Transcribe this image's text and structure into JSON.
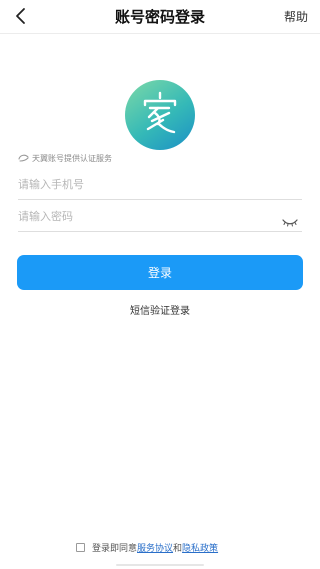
{
  "header": {
    "title": "账号密码登录",
    "help_label": "帮助"
  },
  "service_note": "天翼账号提供认证服务",
  "form": {
    "phone_placeholder": "请输入手机号",
    "phone_value": "",
    "password_placeholder": "请输入密码",
    "password_value": ""
  },
  "login_button_label": "登录",
  "sms_login_label": "短信验证登录",
  "agreement": {
    "prefix": "登录即同意",
    "service_agreement": "服务协议",
    "conjunction": "和",
    "privacy_policy": "隐私政策"
  },
  "colors": {
    "accent": "#1b9af7",
    "logo_gradient_start": "#7dd9a7",
    "logo_gradient_end": "#1b8fc6"
  },
  "icons": {
    "back": "chevron-left-icon",
    "logo": "home-character-logo-icon",
    "service": "tianyi-cloud-icon",
    "eye": "eye-closed-icon"
  }
}
